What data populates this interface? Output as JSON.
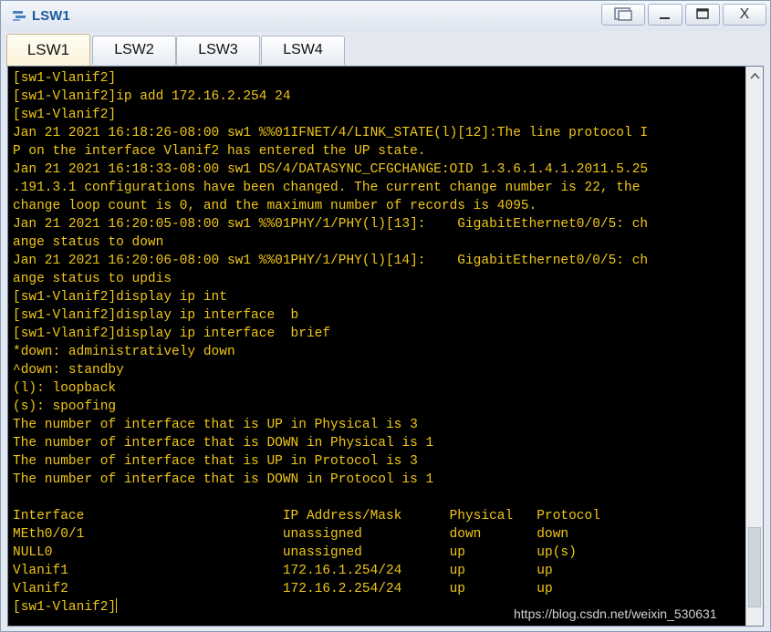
{
  "window": {
    "title": "LSW1",
    "controls": {
      "restore_icon": "restore-window-icon",
      "minimize": "—",
      "maximize": "☐",
      "close": "X"
    }
  },
  "tabs": [
    {
      "label": "LSW1",
      "active": true
    },
    {
      "label": "LSW2",
      "active": false
    },
    {
      "label": "LSW3",
      "active": false
    },
    {
      "label": "LSW4",
      "active": false
    }
  ],
  "terminal": {
    "text_color": "#f0c619",
    "background": "#000000",
    "lines": [
      "[sw1-Vlanif2]",
      "[sw1-Vlanif2]ip add 172.16.2.254 24",
      "[sw1-Vlanif2]",
      "Jan 21 2021 16:18:26-08:00 sw1 %%01IFNET/4/LINK_STATE(l)[12]:The line protocol I",
      "P on the interface Vlanif2 has entered the UP state.",
      "Jan 21 2021 16:18:33-08:00 sw1 DS/4/DATASYNC_CFGCHANGE:OID 1.3.6.1.4.1.2011.5.25",
      ".191.3.1 configurations have been changed. The current change number is 22, the",
      "change loop count is 0, and the maximum number of records is 4095.",
      "Jan 21 2021 16:20:05-08:00 sw1 %%01PHY/1/PHY(l)[13]:    GigabitEthernet0/0/5: ch",
      "ange status to down",
      "Jan 21 2021 16:20:06-08:00 sw1 %%01PHY/1/PHY(l)[14]:    GigabitEthernet0/0/5: ch",
      "ange status to updis",
      "[sw1-Vlanif2]display ip int",
      "[sw1-Vlanif2]display ip interface  b",
      "[sw1-Vlanif2]display ip interface  brief",
      "*down: administratively down",
      "^down: standby",
      "(l): loopback",
      "(s): spoofing",
      "The number of interface that is UP in Physical is 3",
      "The number of interface that is DOWN in Physical is 1",
      "The number of interface that is UP in Protocol is 3",
      "The number of interface that is DOWN in Protocol is 1",
      "",
      "Interface                         IP Address/Mask      Physical   Protocol",
      "MEth0/0/1                         unassigned           down       down",
      "NULL0                             unassigned           up         up(s)",
      "Vlanif1                           172.16.1.254/24      up         up",
      "Vlanif2                           172.16.2.254/24      up         up",
      "[sw1-Vlanif2]"
    ]
  },
  "watermark": "https://blog.csdn.net/weixin_530631"
}
